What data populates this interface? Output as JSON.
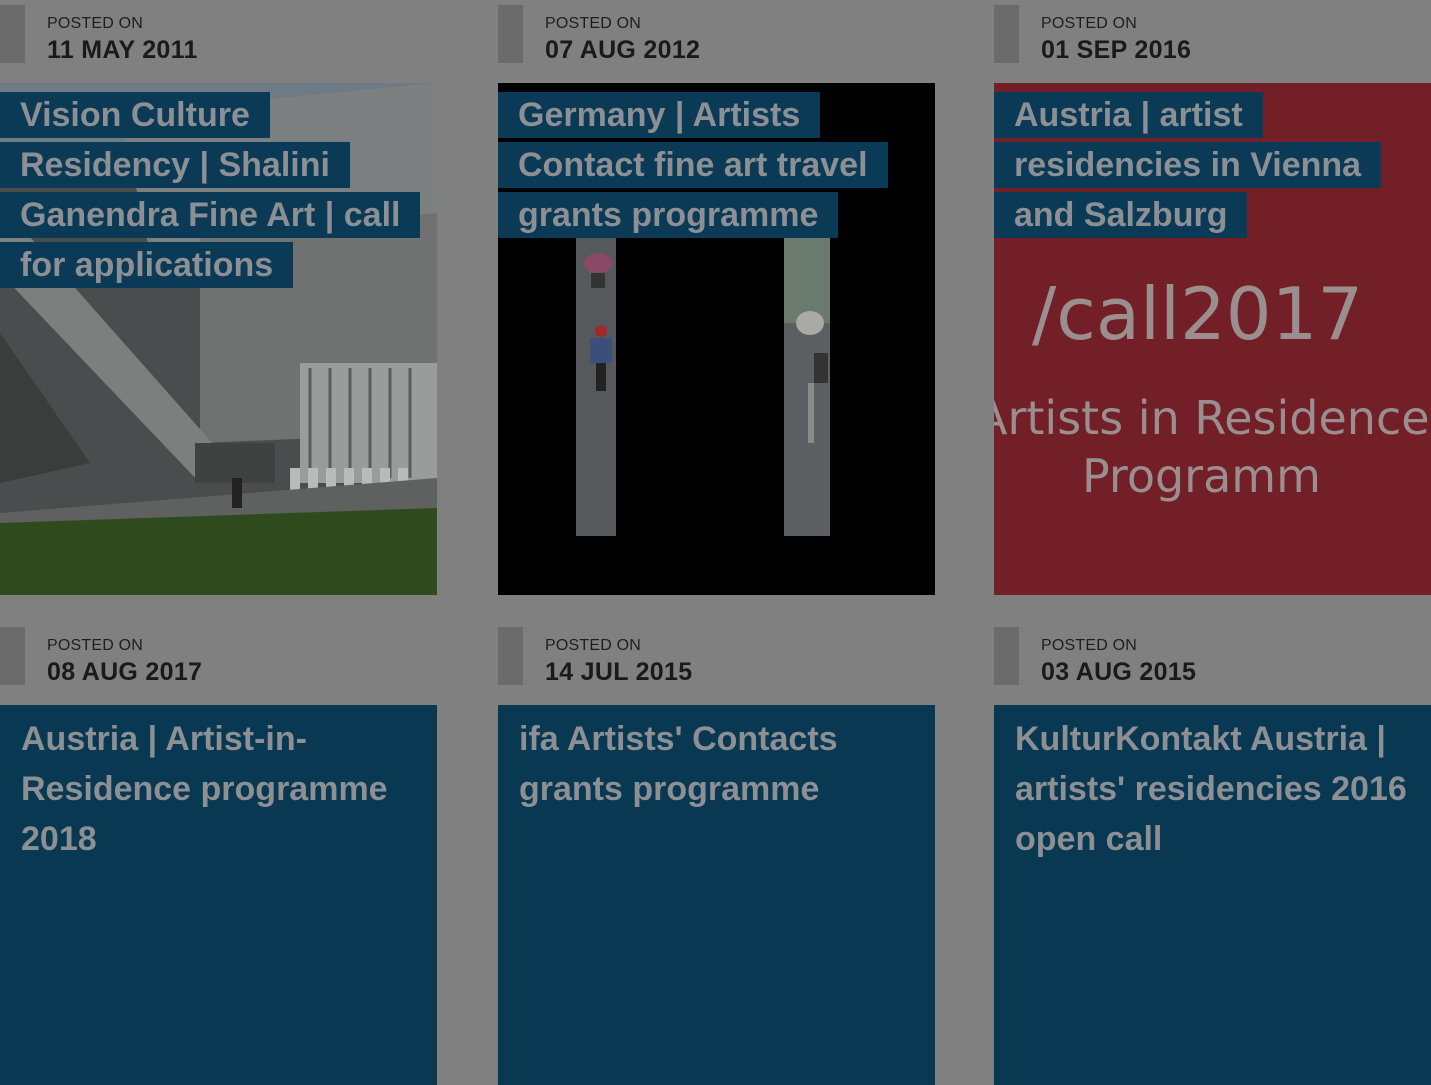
{
  "posts": [
    {
      "label": "POSTED ON",
      "date": "11 MAY 2011",
      "title": "Vision Culture Residency | Shalini Ganendra Fine Art | call for applications"
    },
    {
      "label": "POSTED ON",
      "date": "07 AUG 2012",
      "title": "Germany | Artists Contact fine art travel grants programme"
    },
    {
      "label": "POSTED ON",
      "date": "01 SEP 2016",
      "title": "Austria | artist residencies in Vienna and Salzburg",
      "image_text_1": "/call2017",
      "image_text_2": "Artists in Residence",
      "image_text_3": "Programm"
    },
    {
      "label": "POSTED ON",
      "date": "08 AUG 2017",
      "title": "Austria | Artist-in-Residence programme 2018"
    },
    {
      "label": "POSTED ON",
      "date": "14 JUL 2015",
      "title": "ifa Artists' Contacts grants programme"
    },
    {
      "label": "POSTED ON",
      "date": "03 AUG 2015",
      "title": "KulturKontakt Austria | artists' residencies 2016 open call"
    }
  ]
}
